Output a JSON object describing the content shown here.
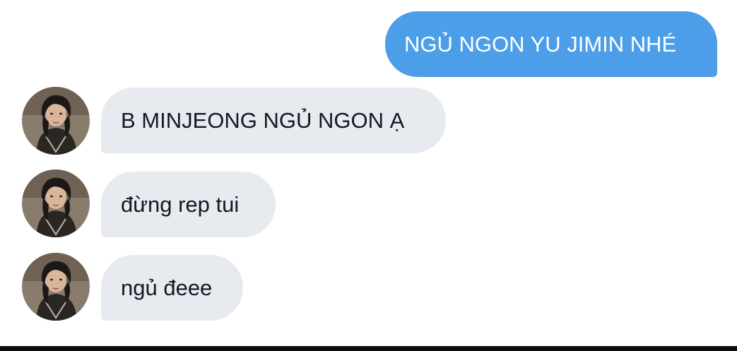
{
  "conversation": {
    "outgoing": [
      {
        "text": "NGỦ NGON YU JIMIN NHÉ"
      }
    ],
    "incoming": [
      {
        "text": "B MINJEONG NGỦ NGON Ạ",
        "avatar": "profile-photo"
      },
      {
        "text": "đừng rep tui",
        "avatar": "profile-photo"
      },
      {
        "text": "ngủ đeee",
        "avatar": "profile-photo"
      }
    ]
  },
  "colors": {
    "outgoing_bubble": "#4d9ee8",
    "incoming_bubble": "#e7eaef",
    "outgoing_text": "#ffffff",
    "incoming_text": "#141823"
  }
}
